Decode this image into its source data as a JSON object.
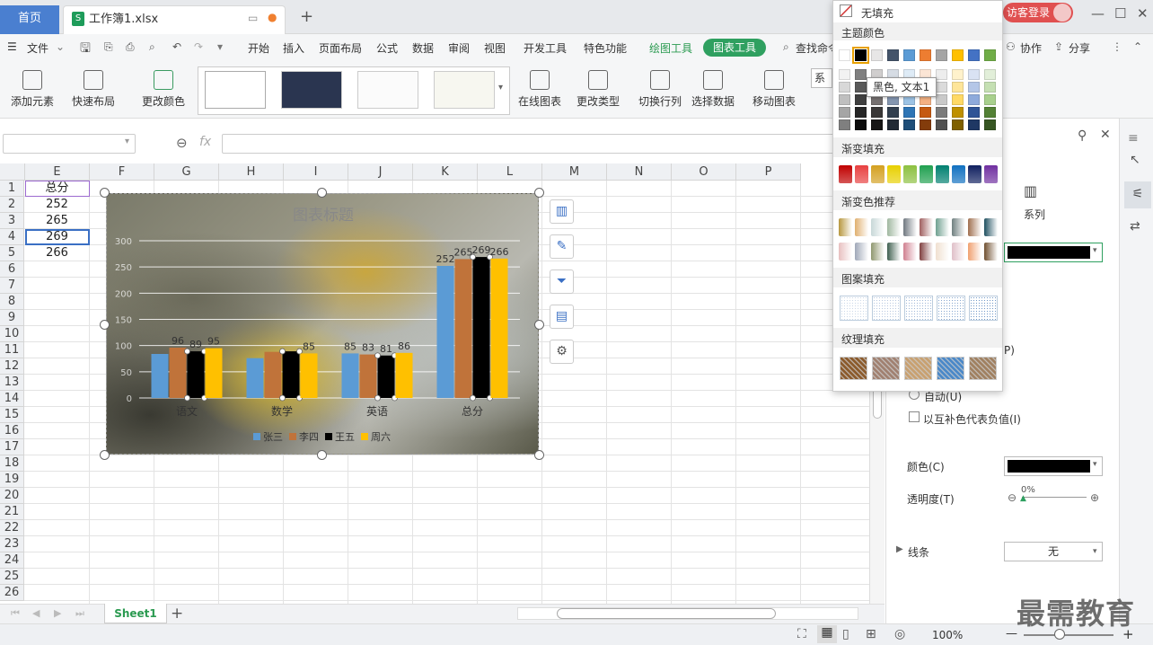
{
  "tabs": {
    "home": "首页",
    "file": "工作簿1.xlsx",
    "login": "访客登录"
  },
  "menubar": {
    "file": "文件",
    "items": [
      "开始",
      "插入",
      "页面布局",
      "公式",
      "数据",
      "审阅",
      "视图",
      "开发工具",
      "特色功能"
    ],
    "draw_tools": "绘图工具",
    "chart_tools": "图表工具",
    "search": "查找命令",
    "collab": "协作",
    "share": "分享"
  },
  "ribbon": {
    "add_element": "添加元素",
    "quick_layout": "快速布局",
    "change_color": "更改颜色",
    "online_chart": "在线图表",
    "change_type": "更改类型",
    "switch_row_col": "切换行列",
    "select_data": "选择数据",
    "move_chart": "移动图表",
    "series_short": "系列"
  },
  "formula": {
    "fx": "fx"
  },
  "grid": {
    "columns": [
      "E",
      "F",
      "G",
      "H",
      "I",
      "J",
      "K",
      "L",
      "M",
      "N",
      "O",
      "P"
    ],
    "rows": [
      "1",
      "2",
      "3",
      "4",
      "5",
      "6",
      "7",
      "8",
      "9",
      "10",
      "11",
      "12",
      "13",
      "14",
      "15",
      "16",
      "17",
      "18",
      "19",
      "20",
      "21",
      "22",
      "23",
      "24",
      "25",
      "26"
    ],
    "cells": [
      "总分",
      "252",
      "265",
      "269",
      "266"
    ]
  },
  "chart_data": {
    "type": "bar",
    "title": "图表标题",
    "categories": [
      "语文",
      "数学",
      "英语",
      "总分"
    ],
    "series": [
      {
        "name": "张三",
        "color": "#5b9bd5",
        "values": [
          84,
          76,
          85,
          252
        ]
      },
      {
        "name": "李四",
        "color": "#c0733a",
        "values": [
          96,
          88,
          83,
          265
        ]
      },
      {
        "name": "王五",
        "color": "#000000",
        "values": [
          89,
          89,
          81,
          269
        ]
      },
      {
        "name": "周六",
        "color": "#ffc000",
        "values": [
          95,
          85,
          86,
          266
        ]
      }
    ],
    "yticks": [
      "300",
      "250",
      "200",
      "150",
      "100",
      "50",
      "0"
    ],
    "ylim": [
      0,
      300
    ],
    "labels_visible": [
      [
        "",
        "96",
        "89",
        "95"
      ],
      [
        "",
        "",
        "",
        "85"
      ],
      [
        "85",
        "83",
        "81",
        "86"
      ],
      [
        "252",
        "265",
        "269",
        "266"
      ]
    ],
    "legend": [
      "张三",
      "李四",
      "王五",
      "周六"
    ]
  },
  "popup": {
    "no_fill": "无填充",
    "theme_colors": "主题颜色",
    "gradient_fill": "渐变填充",
    "gradient_recommend": "渐变色推荐",
    "pattern_fill": "图案填充",
    "texture_fill": "纹理填充",
    "tooltip": "黑色, 文本1",
    "theme_top": [
      "#ffffff",
      "#000000",
      "#e7e6e6",
      "#44546a",
      "#5b9bd5",
      "#ed7d31",
      "#a5a5a5",
      "#ffc000",
      "#4472c4",
      "#70ad47"
    ],
    "theme_shades": [
      [
        "#f2f2f2",
        "#7f7f7f",
        "#d0cece",
        "#d6dce4",
        "#deebf6",
        "#fbe5d5",
        "#ededed",
        "#fff2cc",
        "#d9e2f3",
        "#e2efd9"
      ],
      [
        "#d8d8d8",
        "#595959",
        "#aeabab",
        "#adb9ca",
        "#bdd7ee",
        "#f7cbac",
        "#dbdbdb",
        "#fee599",
        "#b4c6e7",
        "#c5e0b3"
      ],
      [
        "#bfbfbf",
        "#3f3f3f",
        "#757070",
        "#8496b0",
        "#9cc3e5",
        "#f4b183",
        "#c9c9c9",
        "#ffd965",
        "#8eaadb",
        "#a8d08d"
      ],
      [
        "#a5a5a5",
        "#262626",
        "#3a3838",
        "#323f4f",
        "#2e75b5",
        "#c55a11",
        "#7b7b7b",
        "#bf9000",
        "#2f5496",
        "#538135"
      ],
      [
        "#7f7f7f",
        "#0c0c0c",
        "#171616",
        "#222a35",
        "#1e4e79",
        "#833c0b",
        "#525252",
        "#7f6000",
        "#1f3864",
        "#375623"
      ]
    ],
    "gradients": [
      "#c00000",
      "#e84040",
      "#d4a020",
      "#e8d000",
      "#8cc040",
      "#20a050",
      "#008070",
      "#1070c0",
      "#102060",
      "#7030a0"
    ],
    "gradient_rec1": [
      "#b89840",
      "#e0b070",
      "#c8d8d8",
      "#a0b8a0",
      "#707880",
      "#a06060",
      "#70a090",
      "#708080",
      "#a07050",
      "#205060"
    ],
    "gradient_rec2": [
      "#e8c0c0",
      "#a0a8b8",
      "#909870",
      "#406050",
      "#d08090",
      "#804040",
      "#f0e0d0",
      "#e0c0c8",
      "#f0a070",
      "#705030"
    ],
    "patterns": [
      "#ccd8e8",
      "#b8c8e0",
      "#a0b8d8",
      "#88a8d0",
      "#7098c8"
    ],
    "textures": [
      "#8b5a2b",
      "#a08070",
      "#c8a070",
      "#4a88c8",
      "#a08060"
    ]
  },
  "panel": {
    "series_tab": "系列",
    "auto": "自动(U)",
    "invert": "以互补色代表负值(I)",
    "color": "颜色(C)",
    "transparency": "透明度(T)",
    "transparency_value": "0%",
    "line": "线条",
    "line_value": "无",
    "p_hint": "P)"
  },
  "bottom": {
    "sheet": "Sheet1",
    "zoom": "100%"
  },
  "watermark": "最需教育"
}
